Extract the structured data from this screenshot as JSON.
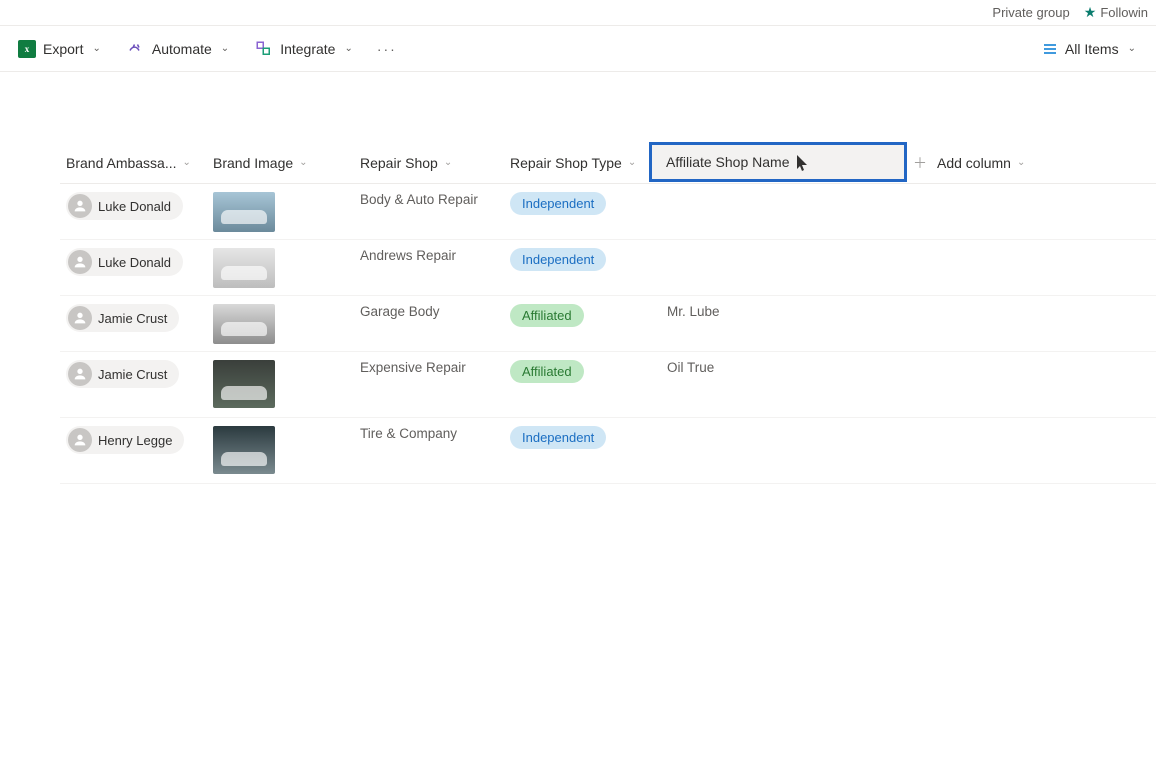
{
  "header": {
    "group_label": "Private group",
    "follow_label": "Followin"
  },
  "commandbar": {
    "export_label": "Export",
    "automate_label": "Automate",
    "integrate_label": "Integrate",
    "all_items_label": "All Items"
  },
  "columns": {
    "ambassador": "Brand Ambassa...",
    "image": "Brand Image",
    "repair_shop": "Repair Shop",
    "shop_type": "Repair Shop Type",
    "affiliate_editing": "Affiliate Shop Name",
    "add_column": "Add column"
  },
  "tags": {
    "independent": "Independent",
    "affiliated": "Affiliated"
  },
  "rows": [
    {
      "ambassador": "Luke Donald",
      "repair_shop": "Body & Auto Repair",
      "type": "independent",
      "affiliate": ""
    },
    {
      "ambassador": "Luke Donald",
      "repair_shop": "Andrews Repair",
      "type": "independent",
      "affiliate": ""
    },
    {
      "ambassador": "Jamie Crust",
      "repair_shop": "Garage Body",
      "type": "affiliated",
      "affiliate": "Mr. Lube"
    },
    {
      "ambassador": "Jamie Crust",
      "repair_shop": "Expensive Repair",
      "type": "affiliated",
      "affiliate": "Oil True"
    },
    {
      "ambassador": "Henry Legge",
      "repair_shop": "Tire & Company",
      "type": "independent",
      "affiliate": ""
    }
  ]
}
